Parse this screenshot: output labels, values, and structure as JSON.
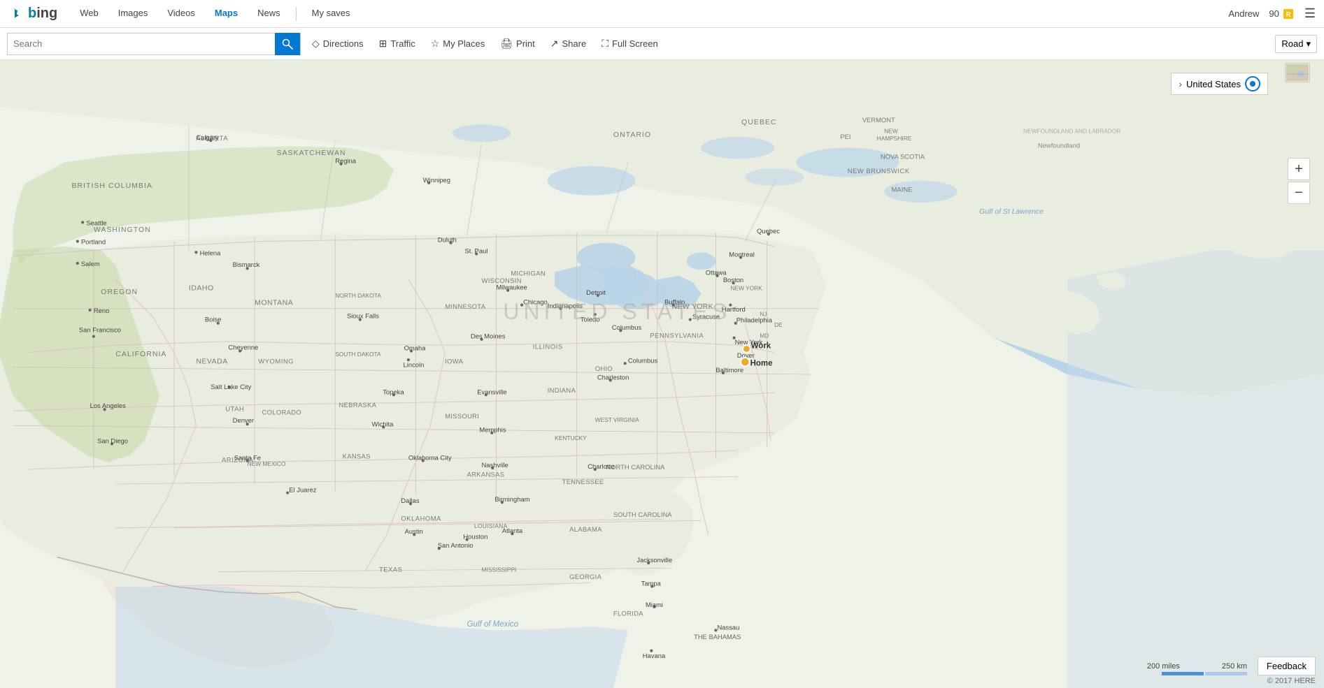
{
  "bing": {
    "logo": "Bing",
    "logo_b": "b",
    "logo_ing": "ing"
  },
  "nav": {
    "links": [
      {
        "label": "Web",
        "name": "nav-web",
        "active": false
      },
      {
        "label": "Images",
        "name": "nav-images",
        "active": false
      },
      {
        "label": "Videos",
        "name": "nav-videos",
        "active": false
      },
      {
        "label": "Maps",
        "name": "nav-maps",
        "active": true
      },
      {
        "label": "News",
        "name": "nav-news",
        "active": false
      }
    ],
    "my_saves": "My saves",
    "user_name": "Andrew",
    "points": "90"
  },
  "toolbar": {
    "search_placeholder": "Search",
    "search_btn_icon": "🔍",
    "directions_label": "Directions",
    "traffic_label": "Traffic",
    "my_places_label": "My Places",
    "print_label": "Print",
    "share_label": "Share",
    "fullscreen_label": "Full Screen",
    "road_label": "Road"
  },
  "map": {
    "location": "United States",
    "us_label": "UNITED STATES",
    "newfoundland_label": "NEWFOUNDLAND AND LABRADOR",
    "zoom_in": "+",
    "zoom_out": "−",
    "work_label": "Work",
    "home_label": "Home",
    "feedback_label": "Feedback",
    "copyright": "© 2017 HERE",
    "scale_200": "200 miles",
    "scale_250": "250 km"
  }
}
